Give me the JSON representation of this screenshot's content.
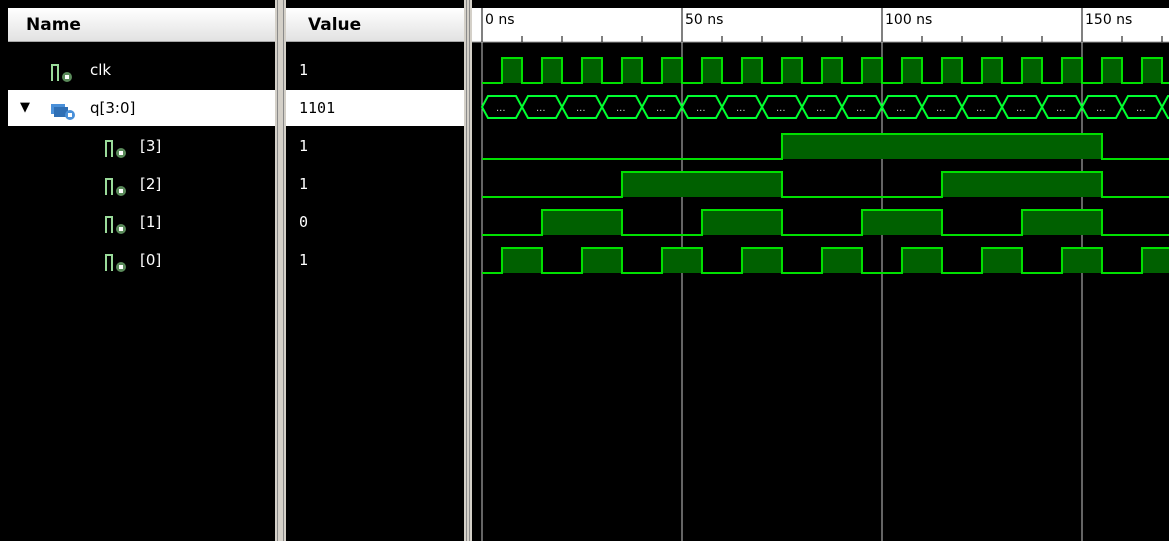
{
  "headers": {
    "name": "Name",
    "value": "Value"
  },
  "signals": [
    {
      "name": "clk",
      "value": "1",
      "icon": "signal-icon",
      "indent": 0
    },
    {
      "name": "q[3:0]",
      "value": "1101",
      "icon": "bus-icon",
      "indent": 0,
      "expanded": true,
      "selected": true
    },
    {
      "name": "[3]",
      "value": "1",
      "icon": "signal-icon",
      "indent": 1
    },
    {
      "name": "[2]",
      "value": "1",
      "icon": "signal-icon",
      "indent": 1
    },
    {
      "name": "[1]",
      "value": "0",
      "icon": "signal-icon",
      "indent": 1
    },
    {
      "name": "[0]",
      "value": "1",
      "icon": "signal-icon",
      "indent": 1
    }
  ],
  "timeline": {
    "ticks": [
      "0 ns",
      "50 ns",
      "100 ns",
      "150 ns"
    ],
    "bus_value_label": "..."
  },
  "colors": {
    "wave": "#00e000",
    "wave_fill": "#006000",
    "bus": "#00ff30",
    "cursor": "#c8c8c8",
    "background": "#000000",
    "header": "#ffffff"
  }
}
